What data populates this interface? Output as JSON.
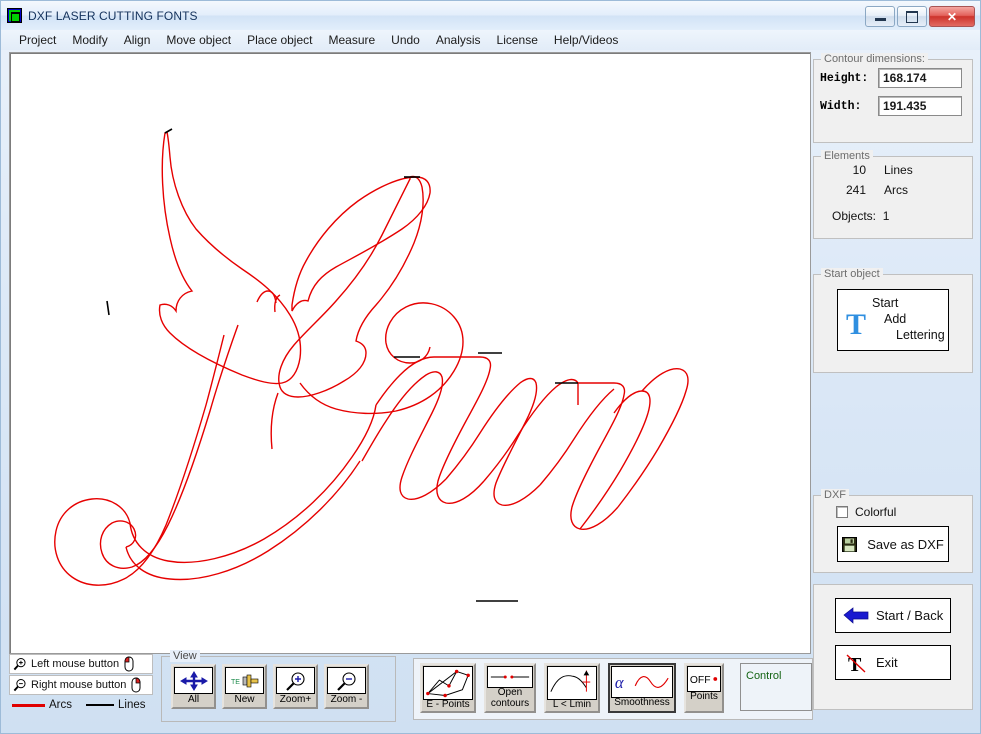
{
  "window": {
    "title": "DXF LASER CUTTING FONTS",
    "icon": "app-icon",
    "buttons": {
      "minimize": "minimize",
      "maximize": "maximize",
      "close": "close"
    }
  },
  "menu": {
    "items": [
      "Project",
      "Modify",
      "Align",
      "Move object",
      "Place object",
      "Measure",
      "Undo",
      "Analysis",
      "License",
      "Help/Videos"
    ]
  },
  "legend": {
    "rows": [
      {
        "icon": "magnifier-plus-icon",
        "label": "Left mouse button",
        "mouse": "mouse-left-icon"
      },
      {
        "icon": "magnifier-minus-icon",
        "label": "Right mouse button",
        "mouse": "mouse-right-icon"
      }
    ],
    "keys": [
      {
        "label": "Arcs",
        "color": "#e00000"
      },
      {
        "label": "Lines",
        "color": "#000000"
      }
    ]
  },
  "view": {
    "title": "View",
    "buttons": [
      {
        "caption": "All",
        "icon": "move-arrows-icon"
      },
      {
        "caption": "New",
        "icon": "paintbrush-text-icon"
      },
      {
        "caption": "Zoom+",
        "icon": "magnifier-plus-icon"
      },
      {
        "caption": "Zoom -",
        "icon": "magnifier-minus-icon"
      }
    ]
  },
  "control": {
    "label": "Control",
    "label_color": "#146414",
    "buttons": [
      {
        "caption": "E - Points",
        "icon": "polygon-endpoints-icon",
        "pressed": false
      },
      {
        "caption": "Open\ncontours",
        "caption1": "Open",
        "caption2": "contours",
        "icon": "open-contour-icon",
        "pressed": false
      },
      {
        "caption": "L < Lmin",
        "icon": "short-segment-icon",
        "pressed": false
      },
      {
        "caption": "Smoothness",
        "icon": "alpha-curve-icon",
        "pressed": true
      },
      {
        "caption": "Points",
        "icon": "off-points-icon",
        "state": "OFF",
        "pressed": false
      }
    ]
  },
  "contour_dimensions": {
    "title": "Contour dimensions:",
    "height_label": "Height:",
    "height_value": "168.174",
    "width_label": "Width:",
    "width_value": "191.435"
  },
  "elements": {
    "title": "Elements",
    "rows": [
      {
        "count": "10",
        "label": "Lines"
      },
      {
        "count": "241",
        "label": "Arcs"
      }
    ],
    "objects_label": "Objects:",
    "objects_value": "1"
  },
  "start_object": {
    "title": "Start object",
    "icon": "letter-t-icon",
    "line1": "Start",
    "line2": "Add",
    "line3": "Lettering"
  },
  "dxf": {
    "title": "DXF",
    "colorful_label": "Colorful",
    "colorful_checked": false,
    "save_label": "Save as DXF",
    "save_icon": "floppy-disk-icon"
  },
  "navigation": {
    "start_back_label": "Start / Back",
    "start_back_icon": "arrow-left-icon",
    "exit_label": "Exit",
    "exit_icon": "letter-t-crossed-icon"
  },
  "canvas": {
    "arc_color": "#e60000",
    "line_color": "#000000",
    "background": "#ffffff",
    "artwork": "butterfly-and-sun-script-outline"
  }
}
